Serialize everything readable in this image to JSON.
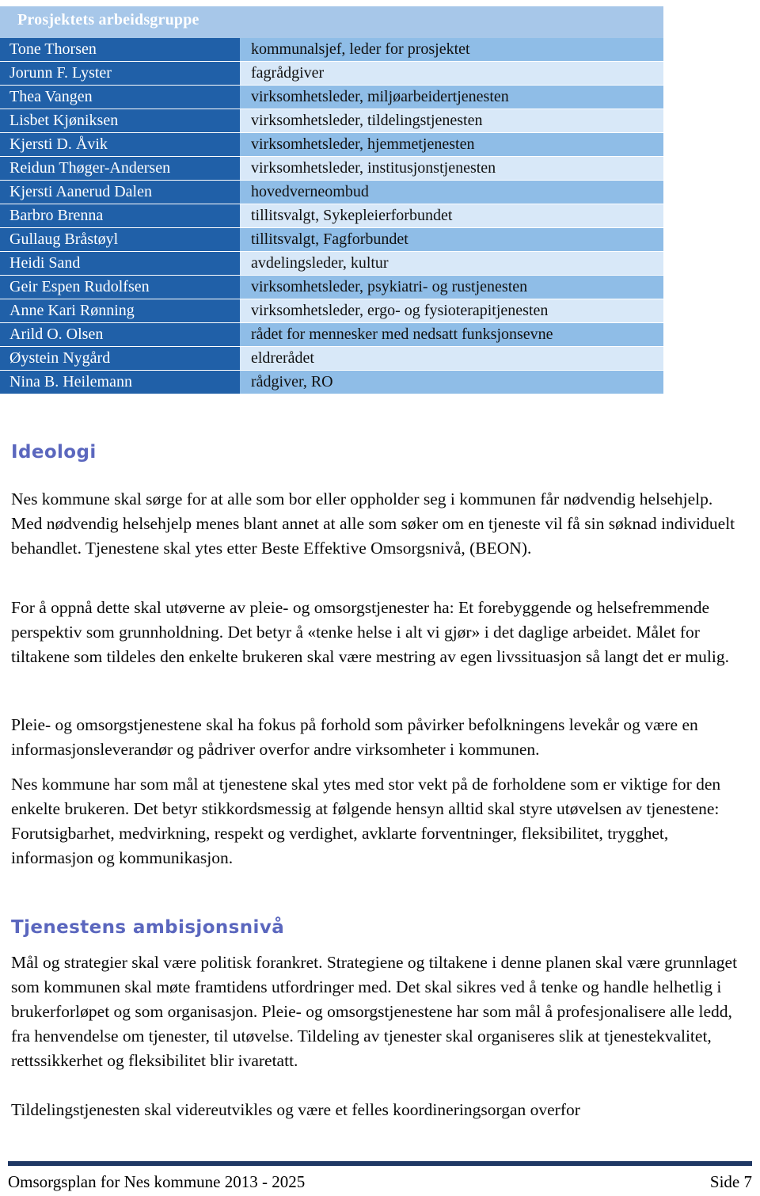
{
  "workgroup_table": {
    "title": "Prosjektets arbeidsgruppe",
    "rows": [
      {
        "name": "Tone Thorsen",
        "role": "kommunalsjef, leder for prosjektet"
      },
      {
        "name": "Jorunn  F. Lyster",
        "role": "fagrådgiver"
      },
      {
        "name": "Thea Vangen",
        "role": "virksomhetsleder, miljøarbeidertjenesten"
      },
      {
        "name": "Lisbet Kjøniksen",
        "role": "virksomhetsleder, tildelingstjenesten"
      },
      {
        "name": "Kjersti D. Åvik",
        "role": "virksomhetsleder, hjemmetjenesten"
      },
      {
        "name": "Reidun Thøger-Andersen",
        "role": "virksomhetsleder, institusjonstjenesten"
      },
      {
        "name": "Kjersti Aanerud Dalen",
        "role": "hovedverneombud"
      },
      {
        "name": "Barbro Brenna",
        "role": "tillitsvalgt, Sykepleierforbundet"
      },
      {
        "name": "Gullaug Bråstøyl",
        "role": "tillitsvalgt, Fagforbundet"
      },
      {
        "name": "Heidi Sand",
        "role": "avdelingsleder, kultur"
      },
      {
        "name": "Geir Espen Rudolfsen",
        "role": "virksomhetsleder, psykiatri- og rustjenesten"
      },
      {
        "name": "Anne Kari Rønning",
        "role": "virksomhetsleder, ergo- og fysioterapitjenesten"
      },
      {
        "name": "Arild O. Olsen",
        "role": "rådet for mennesker med nedsatt funksjonsevne"
      },
      {
        "name": "Øystein Nygård",
        "role": "eldrerådet"
      },
      {
        "name": "Nina B. Heilemann",
        "role": "rådgiver, RO"
      }
    ]
  },
  "sections": {
    "ideologi": {
      "heading": "Ideologi",
      "paragraphs": {
        "p1": "Nes kommune skal sørge for at alle som bor eller oppholder seg i kommunen får nødvendig helsehjelp. Med nødvendig helsehjelp menes blant annet at alle som søker om en tjeneste vil få sin søknad individuelt behandlet. Tjenestene skal ytes etter Beste Effektive Omsorgsnivå, (BEON).",
        "p2": "For å oppnå dette skal utøverne av pleie- og omsorgstjenester ha: Et forebyggende og helsefremmende perspektiv som grunnholdning. Det betyr å «tenke helse i alt vi gjør» i det daglige arbeidet. Målet for tiltakene som tildeles den enkelte brukeren skal være mestring av egen livssituasjon så langt det er mulig.",
        "p3": "Pleie- og omsorgstjenestene skal ha fokus på forhold som påvirker befolkningens levekår og være en informasjonsleverandør og pådriver overfor andre virksomheter i kommunen.",
        "p4": "Nes kommune har som mål at tjenestene skal ytes med stor vekt på de forholdene som er viktige for den enkelte brukeren. Det betyr stikkordsmessig at følgende hensyn alltid skal styre utøvelsen av tjenestene: Forutsigbarhet, medvirkning, respekt og verdighet, avklarte forventninger, fleksibilitet, trygghet, informasjon og kommunikasjon."
      }
    },
    "ambisjonsniva": {
      "heading": "Tjenestens ambisjonsnivå",
      "paragraphs": {
        "p5": "Mål og strategier skal være politisk forankret. Strategiene og tiltakene i denne planen skal være grunnlaget som kommunen skal møte framtidens utfordringer med. Det skal sikres ved å tenke og handle helhetlig i brukerforløpet og som organisasjon. Pleie- og omsorgstjenestene har som mål å profesjonalisere alle ledd, fra henvendelse om tjenester, til utøvelse. Tildeling av tjenester skal organiseres slik at tjenestekvalitet, rettssikkerhet og fleksibilitet blir ivaretatt.",
        "p6": "Tildelingstjenesten skal videreutvikles og være et felles koordineringsorgan overfor"
      }
    }
  },
  "footer": {
    "document_title": "Omsorgsplan for Nes kommune 2013 - 2025",
    "page_label": "Side 7"
  },
  "colors": {
    "table_header_band": "#A7C7E9",
    "name_cell": "#2060A8",
    "role_cell_dark": "#8FBDE7",
    "role_cell_light": "#D8E8F8",
    "heading_blue": "#5B67BE",
    "footer_rule": "#1F3864"
  }
}
